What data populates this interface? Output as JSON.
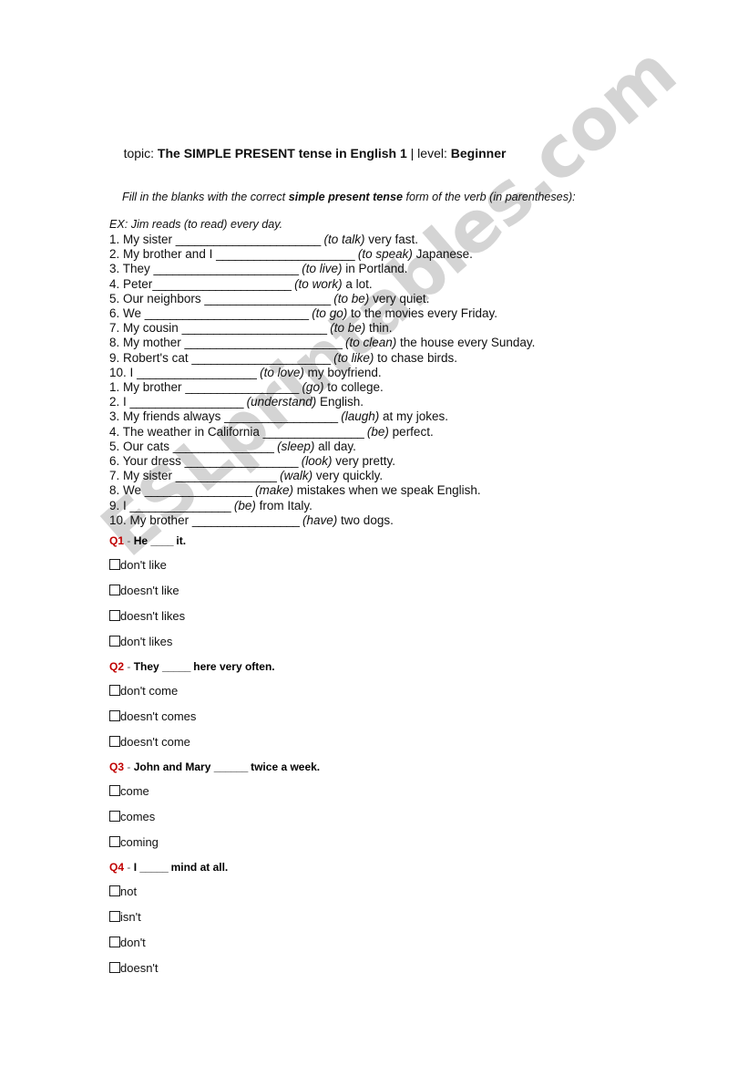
{
  "watermark": {
    "text": "ESLprintables.com",
    "color": "#d2d2d2"
  },
  "header": {
    "topic_label": "topic:",
    "topic_value": "The SIMPLE PRESENT tense in English 1",
    "separator": "|",
    "level_label": "level:",
    "level_value": "Beginner"
  },
  "instructions": {
    "before_bold": "Fill in the blanks with the correct ",
    "bold": "simple present tense",
    "after_bold": " form of the verb (in parentheses):",
    "example": "EX: Jim reads (to read) every day."
  },
  "exercise_set_1": [
    {
      "num": "1.",
      "before": "My sister ",
      "blank": "_______________________",
      "verb": "(to talk)",
      "after": " very fast."
    },
    {
      "num": "2.",
      "before": "My brother and I ",
      "blank": "______________________",
      "verb": "(to speak)",
      "after": " Japanese."
    },
    {
      "num": "3.",
      "before": "They ",
      "blank": "_______________________",
      "verb": "(to live)",
      "after": " in Portland."
    },
    {
      "num": "4.",
      "before": "Peter",
      "blank": "______________________",
      "verb": "(to work)",
      "after": " a lot."
    },
    {
      "num": "5.",
      "before": "Our neighbors ",
      "blank": "____________________",
      "verb": "(to be)",
      "after": " very quiet."
    },
    {
      "num": "6.",
      "before": "We ",
      "blank": "__________________________",
      "verb": "(to go)",
      "after": " to the movies every Friday."
    },
    {
      "num": "7.",
      "before": "My cousin ",
      "blank": "_______________________",
      "verb": "(to be)",
      "after": " thin."
    },
    {
      "num": "8.",
      "before": "My mother ",
      "blank": "_________________________",
      "verb": "(to clean)",
      "after": " the house every Sunday."
    },
    {
      "num": "9.",
      "before": "Robert's cat ",
      "blank": "______________________",
      "verb": "(to like)",
      "after": " to chase birds."
    },
    {
      "num": "10.",
      "before": "I ",
      "blank": "___________________",
      "verb": "(to love)",
      "after": " my boyfriend."
    }
  ],
  "exercise_set_2": [
    {
      "num": "1.",
      "before": "My brother ",
      "blank": "__________________",
      "verb": "(go)",
      "after": " to college."
    },
    {
      "num": "2.",
      "before": "I ",
      "blank": "__________________",
      "verb": "(understand)",
      "after": " English."
    },
    {
      "num": "3.",
      "before": "My friends always ",
      "blank": "__________________",
      "verb": "(laugh)",
      "after": " at my jokes."
    },
    {
      "num": "4.",
      "before": "The weather in California ",
      "blank": "________________",
      "verb": "(be)",
      "after": " perfect."
    },
    {
      "num": "5.",
      "before": "Our cats ",
      "blank": "________________",
      "verb": "(sleep)",
      "after": " all day."
    },
    {
      "num": "6.",
      "before": "Your dress ",
      "blank": "__________________",
      "verb": "(look)",
      "after": " very pretty."
    },
    {
      "num": "7.",
      "before": "My sister ",
      "blank": "________________",
      "verb": "(walk)",
      "after": " very quickly."
    },
    {
      "num": "8.",
      "before": "We ",
      "blank": "_________________",
      "verb": "(make)",
      "after": " mistakes when we speak English."
    },
    {
      "num": "9.",
      "before": "I ",
      "blank": "________________",
      "verb": "(be)",
      "after": " from Italy."
    },
    {
      "num": "10.",
      "before": "My brother ",
      "blank": "_________________",
      "verb": "(have)",
      "after": " two dogs."
    }
  ],
  "questions": [
    {
      "num": "Q1",
      "dash": "-",
      "stem_before": "He ",
      "stem_blank": "____",
      "stem_after": " it.",
      "options": [
        "don't like",
        "doesn't like",
        "doesn't likes",
        "don't likes"
      ]
    },
    {
      "num": "Q2",
      "dash": "-",
      "stem_before": "They ",
      "stem_blank": "_____",
      "stem_after": " here very often.",
      "options": [
        "don't come",
        "doesn't comes",
        "doesn't come"
      ]
    },
    {
      "num": "Q3",
      "dash": "-",
      "stem_before": "John and Mary ",
      "stem_blank": "______",
      "stem_after": " twice a week.",
      "options": [
        "come",
        "comes",
        "coming"
      ]
    },
    {
      "num": "Q4",
      "dash": "-",
      "stem_before": "I ",
      "stem_blank": "_____",
      "stem_after": " mind at all.",
      "options": [
        "not",
        "isn't",
        "don't",
        "doesn't"
      ]
    }
  ]
}
